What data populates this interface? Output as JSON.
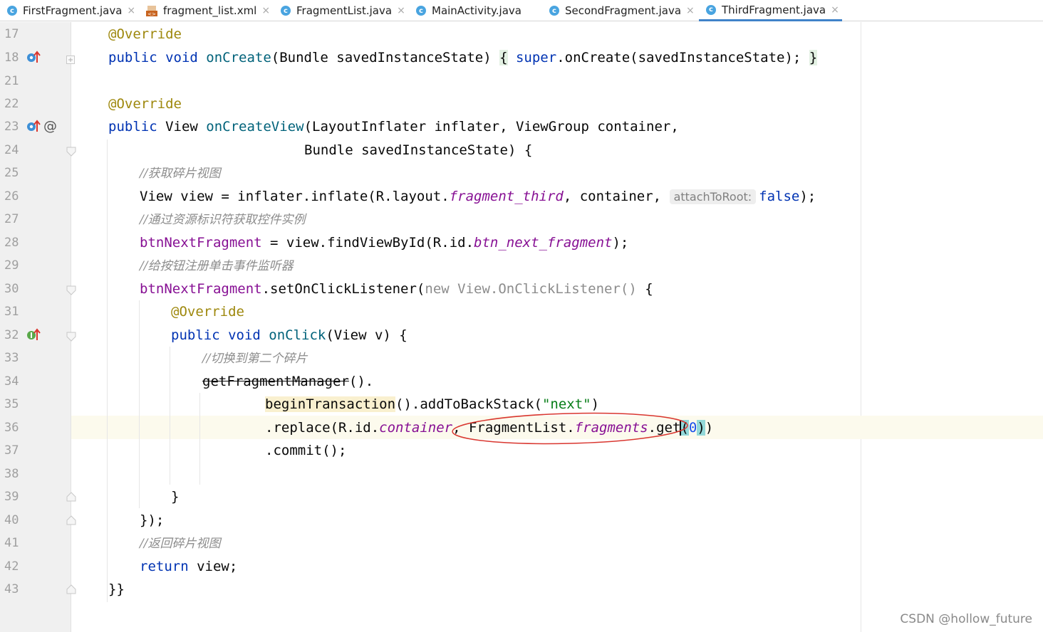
{
  "tabs": [
    {
      "label": "FirstFragment.java",
      "icon": "class-icon"
    },
    {
      "label": "fragment_list.xml",
      "icon": "xml-file-icon"
    },
    {
      "label": "FragmentList.java",
      "icon": "class-icon"
    },
    {
      "label": "MainActivity.java",
      "icon": "class-icon"
    },
    {
      "label": "SecondFragment.java",
      "icon": "class-icon"
    },
    {
      "label": "ThirdFragment.java",
      "icon": "class-icon",
      "active": true
    }
  ],
  "tab_icon_letter": "c",
  "close_glyph": "×",
  "line_numbers": [
    "17",
    "18",
    "21",
    "22",
    "23",
    "24",
    "25",
    "26",
    "27",
    "28",
    "29",
    "30",
    "31",
    "32",
    "33",
    "34",
    "35",
    "36",
    "37",
    "38",
    "39",
    "40",
    "41",
    "42",
    "43"
  ],
  "code": {
    "l17_ann": "@Override",
    "l18_kw1": "public void ",
    "l18_m": "onCreate",
    "l18_rest": "(Bundle savedInstanceState) ",
    "l18_lb": "{",
    "l18_super": " super",
    "l18_call": ".onCreate(savedInstanceState); ",
    "l18_rb": "}",
    "l22_ann": "@Override",
    "l23_kw": "public ",
    "l23_t": "View ",
    "l23_m": "onCreateView",
    "l23_rest": "(LayoutInflater inflater, ViewGroup container,",
    "l24": "Bundle savedInstanceState) {",
    "l25_cmt": "//获取碎片视图",
    "l26_a": "View view = inflater.inflate(R.layout.",
    "l26_f": "fragment_third",
    "l26_b": ", container, ",
    "l26_hint": "attachToRoot:",
    "l26_false": "false",
    "l26_end": ");",
    "l27_cmt": "//通过资源标识符获取控件实例",
    "l28_f": "btnNextFragment",
    "l28_a": " = view.findViewById(R.id.",
    "l28_id": "btn_next_fragment",
    "l28_end": ");",
    "l29_cmt": "//给按钮注册单击事件监听器",
    "l30_f": "btnNextFragment",
    "l30_a": ".setOnClickListener(",
    "l30_new": "new View.OnClickListener()",
    "l30_end": " {",
    "l31_ann": "@Override",
    "l32_kw": "public void ",
    "l32_m": "onClick",
    "l32_rest": "(View v) {",
    "l33_cmt": "//切换到第二个碎片",
    "l34_strike": "getFragmentManager",
    "l34_rest": "().",
    "l35_warn": "beginTransaction",
    "l35_a": "().addToBackStack(",
    "l35_str": "\"next\"",
    "l35_end": ")",
    "l36_a": ".replace(R.id.",
    "l36_id": "container",
    "l36_b": ", FragmentList.",
    "l36_f": "fragments",
    "l36_c": ".get",
    "l36_lp": "(",
    "l36_zero": "0",
    "l36_rp": ")",
    "l36_end": ")",
    "l37": ".commit();",
    "l39": "}",
    "l40": "});",
    "l41_cmt": "//返回碎片视图",
    "l42_kw": "return ",
    "l42_rest": "view;",
    "l43": "}}"
  },
  "watermark": "CSDN @hollow_future",
  "gutter_icons": {
    "l18": "override-up-icon",
    "l23": "override-up-icon",
    "l23_at": "@",
    "l32": "implement-up-icon"
  },
  "colors": {
    "keyword": "#0033b3",
    "annotation": "#9e880d",
    "method": "#00627a",
    "field": "#871094",
    "string": "#067d17",
    "comment": "#8c8c8c",
    "active_tab": "#4083c9",
    "annotation_circle": "#d9362f"
  }
}
